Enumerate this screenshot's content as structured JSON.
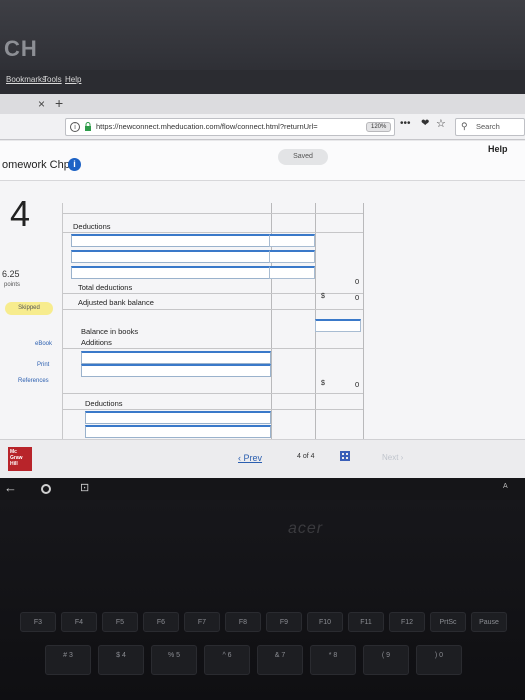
{
  "browser": {
    "app_badge": "CH",
    "menu": [
      "Bookmarks",
      "Tools",
      "Help"
    ],
    "tab": {
      "close": "×",
      "new": "+"
    },
    "url": "https://newconnect.mheducation.com/flow/connect.html?returnUrl=",
    "zoom": "120%",
    "more_icon": "•••",
    "search_placeholder": "Search"
  },
  "page": {
    "saved": "Saved",
    "help": "Help",
    "homework_title": "omework Chp 9",
    "question_number": "4",
    "points_value": "6.25",
    "points_label": "points",
    "status": "Skipped",
    "links": {
      "ebook": "eBook",
      "print": "Print",
      "references": "References"
    }
  },
  "worksheet": {
    "deductions_label": "Deductions",
    "total_deductions_label": "Total deductions",
    "total_deductions_value": "0",
    "adjusted_balance_label": "Adjusted bank balance",
    "adjusted_balance_value": "0",
    "balance_books_label": "Balance in books",
    "additions_label": "Additions",
    "books_total_value": "0",
    "deductions2_label": "Deductions",
    "currency": "$"
  },
  "footer": {
    "logo_text": "Mc Graw Hill",
    "prev": "Prev",
    "page_current": "4",
    "page_of": "of",
    "page_total": "4",
    "next": "Next"
  },
  "shelf": {
    "back_icon": "←",
    "overview_icon": "⊡",
    "locale": "A"
  },
  "keyboard": {
    "brand": "acer",
    "fkeys": [
      "F3",
      "F4",
      "F5",
      "F6",
      "F7",
      "F8",
      "F9",
      "F10",
      "F11",
      "F12",
      "PrtSc",
      "Pause"
    ],
    "numbers": [
      "#",
      "$",
      "%",
      "^",
      "&",
      "*",
      "(",
      ")"
    ],
    "number_sub": [
      "3",
      "4",
      "5",
      "6",
      "7",
      "8",
      "9",
      "0"
    ]
  }
}
